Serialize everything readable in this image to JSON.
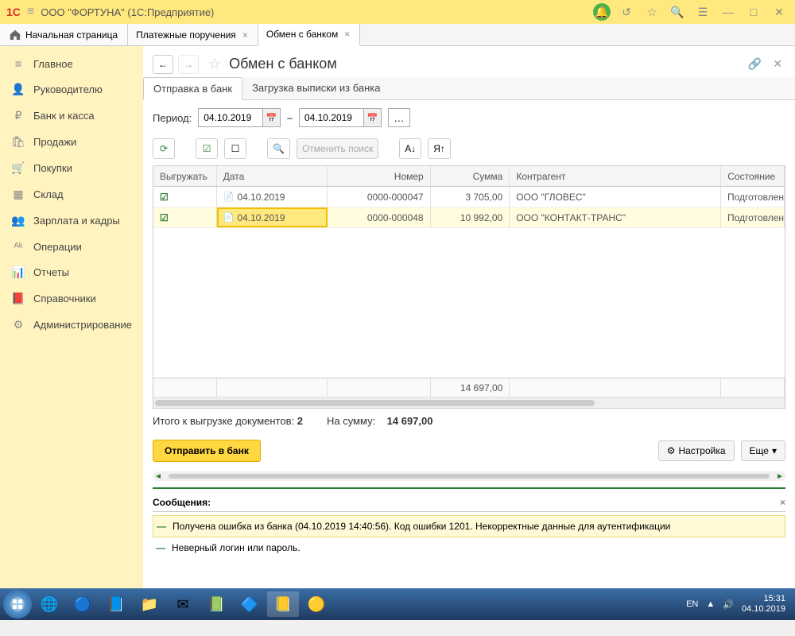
{
  "titlebar": {
    "app_title": "ООО \"ФОРТУНА\"  (1С:Предприятие)"
  },
  "tabs": {
    "home": "Начальная страница",
    "items": [
      {
        "label": "Платежные поручения"
      },
      {
        "label": "Обмен с банком"
      }
    ]
  },
  "sidebar": {
    "items": [
      {
        "icon": "≡",
        "label": "Главное"
      },
      {
        "icon": "👤",
        "label": "Руководителю"
      },
      {
        "icon": "₽",
        "label": "Банк и касса"
      },
      {
        "icon": "🛍",
        "label": "Продажи"
      },
      {
        "icon": "🛒",
        "label": "Покупки"
      },
      {
        "icon": "▦",
        "label": "Склад"
      },
      {
        "icon": "👥",
        "label": "Зарплата и кадры"
      },
      {
        "icon": "ᴬᵏ",
        "label": "Операции"
      },
      {
        "icon": "📊",
        "label": "Отчеты"
      },
      {
        "icon": "📕",
        "label": "Справочники"
      },
      {
        "icon": "⚙",
        "label": "Администрирование"
      }
    ]
  },
  "page": {
    "title": "Обмен с банком",
    "subtabs": [
      {
        "label": "Отправка в банк",
        "active": true
      },
      {
        "label": "Загрузка выписки из банка",
        "active": false
      }
    ],
    "period": {
      "label": "Период:",
      "from": "04.10.2019",
      "dash": "–",
      "to": "04.10.2019"
    },
    "toolbar": {
      "cancel_search": "Отменить поиск"
    },
    "table": {
      "headers": {
        "export": "Выгружать",
        "date": "Дата",
        "number": "Номер",
        "sum": "Сумма",
        "counterparty": "Контрагент",
        "state": "Состояние"
      },
      "rows": [
        {
          "date": "04.10.2019",
          "number": "0000-000047",
          "sum": "3 705,00",
          "counterparty": "ООО \"ГЛОВЕС\"",
          "state": "Подготовлен"
        },
        {
          "date": "04.10.2019",
          "number": "0000-000048",
          "sum": "10 992,00",
          "counterparty": "ООО  \"КОНТАКТ-ТРАНС\"",
          "state": "Подготовлен"
        }
      ],
      "footer_sum": "14 697,00"
    },
    "summary": {
      "docs_label": "Итого к выгрузке документов:",
      "docs_count": "2",
      "sum_label": "На сумму:",
      "sum_value": "14 697,00"
    },
    "actions": {
      "send": "Отправить в банк",
      "settings": "Настройка",
      "more": "Еще"
    },
    "messages": {
      "title": "Сообщения:",
      "items": [
        "Получена ошибка из банка (04.10.2019 14:40:56). Код ошибки 1201. Некорректные данные для аутентификации",
        "Неверный логин или пароль."
      ]
    }
  },
  "taskbar": {
    "lang": "EN",
    "time": "15:31",
    "date": "04.10.2019"
  }
}
